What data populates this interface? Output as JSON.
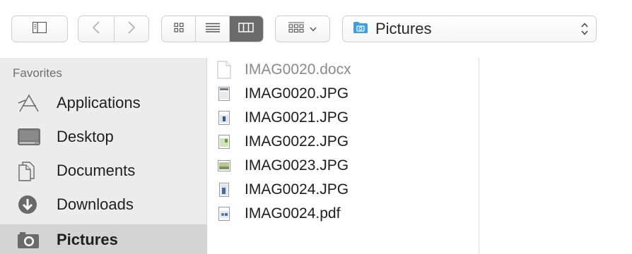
{
  "toolbar": {
    "sidebar_toggle_icon": "sidebar-toggle-icon",
    "back_icon": "chevron-left-icon",
    "forward_icon": "chevron-right-icon",
    "view_modes": [
      {
        "name": "icon-view",
        "icon": "grid-icon",
        "active": false
      },
      {
        "name": "list-view",
        "icon": "list-icon",
        "active": false
      },
      {
        "name": "column-view",
        "icon": "columns-icon",
        "active": true
      }
    ],
    "arrange_icon": "arrange-grid-icon",
    "path_popup": {
      "label": "Pictures",
      "icon": "pictures-folder-icon"
    }
  },
  "sidebar": {
    "heading": "Favorites",
    "items": [
      {
        "label": "Applications",
        "icon": "applications-icon",
        "selected": false
      },
      {
        "label": "Desktop",
        "icon": "desktop-icon",
        "selected": false
      },
      {
        "label": "Documents",
        "icon": "documents-icon",
        "selected": false
      },
      {
        "label": "Downloads",
        "icon": "downloads-icon",
        "selected": false
      },
      {
        "label": "Pictures",
        "icon": "camera-icon",
        "selected": true
      }
    ]
  },
  "files": [
    {
      "name": "IMAG0020.docx",
      "icon": "blank-document-icon",
      "dimmed": true
    },
    {
      "name": "IMAG0020.JPG",
      "icon": "image-thumbnail-icon",
      "dimmed": false
    },
    {
      "name": "IMAG0021.JPG",
      "icon": "image-thumbnail-icon",
      "dimmed": false
    },
    {
      "name": "IMAG0022.JPG",
      "icon": "image-thumbnail-icon",
      "dimmed": false
    },
    {
      "name": "IMAG0023.JPG",
      "icon": "image-thumbnail-icon",
      "dimmed": false
    },
    {
      "name": "IMAG0024.JPG",
      "icon": "image-thumbnail-icon",
      "dimmed": false
    },
    {
      "name": "IMAG0024.pdf",
      "icon": "pdf-document-icon",
      "dimmed": false
    }
  ],
  "colors": {
    "sidebar_bg": "#ececec",
    "sidebar_selected": "#d4d4d4",
    "active_segment": "#6b6b6b",
    "folder_blue": "#3aa0e6"
  }
}
